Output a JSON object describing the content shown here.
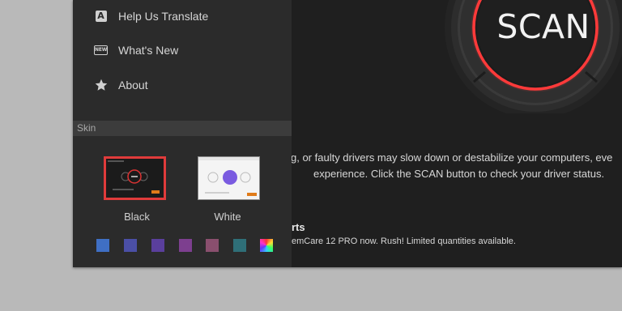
{
  "sidebar": {
    "items": [
      {
        "label": "Help Us Translate",
        "icon": "translate-icon"
      },
      {
        "label": "What's New",
        "icon": "new-badge-icon"
      },
      {
        "label": "About",
        "icon": "star-icon"
      }
    ],
    "skin": {
      "header": "Skin",
      "themes": [
        {
          "label": "Black",
          "selected": true
        },
        {
          "label": "White",
          "selected": false
        }
      ],
      "swatches": [
        "#3f6fc4",
        "#4b4fa6",
        "#5a3f9c",
        "#7d3f8f",
        "#8a4f6e",
        "#2f6f78",
        "gradient"
      ]
    }
  },
  "main": {
    "scan_button": "SCAN",
    "description_line1": "g, or faulty drivers may slow down or destabilize your computers, eve",
    "description_line2": "experience. Click the SCAN button to check your driver status.",
    "promo_title": "rts",
    "promo_text": "emCare 12 PRO now. Rush! Limited quantities available."
  },
  "colors": {
    "accent_red": "#e03b3b",
    "sidebar_bg": "#2b2b2b",
    "main_bg": "#1f1f1f",
    "desktop_bg": "#b9b9b9"
  }
}
